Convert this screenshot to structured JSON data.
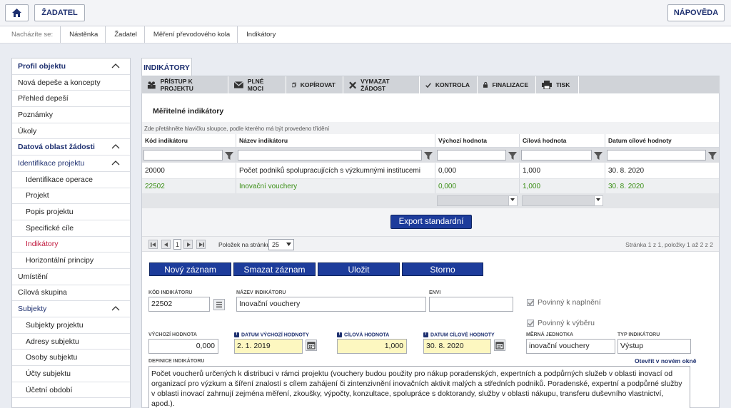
{
  "header": {
    "user_label": "ŽADATEL",
    "help_label": "NÁPOVĚDA"
  },
  "breadcrumb": [
    "Nacházíte se:",
    "Nástěnka",
    "Žadatel",
    "Měření převodového kola",
    "Indikátory"
  ],
  "sidebar": {
    "items": [
      {
        "label": "Profil objektu",
        "kind": "head",
        "chev": true
      },
      {
        "label": "Nová depeše a koncepty",
        "kind": "plain"
      },
      {
        "label": "Přehled depeší",
        "kind": "plain"
      },
      {
        "label": "Poznámky",
        "kind": "plain"
      },
      {
        "label": "Úkoly",
        "kind": "plain"
      },
      {
        "label": "Datová oblast žádosti",
        "kind": "head",
        "chev": true
      },
      {
        "label": "Identifikace projektu",
        "kind": "subhead",
        "chev": true
      },
      {
        "label": "Identifikace operace",
        "kind": "sub"
      },
      {
        "label": "Projekt",
        "kind": "sub"
      },
      {
        "label": "Popis projektu",
        "kind": "sub"
      },
      {
        "label": "Specifické cíle",
        "kind": "sub"
      },
      {
        "label": "Indikátory",
        "kind": "sub",
        "active": true
      },
      {
        "label": "Horizontální principy",
        "kind": "sub"
      },
      {
        "label": "Umístění",
        "kind": "plain"
      },
      {
        "label": "Cílová skupina",
        "kind": "plain"
      },
      {
        "label": "Subjekty",
        "kind": "subhead",
        "chev": true
      },
      {
        "label": "Subjekty projektu",
        "kind": "sub"
      },
      {
        "label": "Adresy subjektu",
        "kind": "sub"
      },
      {
        "label": "Osoby subjektu",
        "kind": "sub"
      },
      {
        "label": "Účty subjektu",
        "kind": "sub"
      },
      {
        "label": "Účetní období",
        "kind": "sub"
      }
    ]
  },
  "tab": {
    "label": "INDIKÁTORY"
  },
  "toolbar": {
    "access": "PŘÍSTUP K PROJEKTU",
    "power": "PLNÉ MOCI",
    "copy": "KOPÍROVAT",
    "delete": "VYMAZAT ŽÁDOST",
    "check": "KONTROLA",
    "finalize": "FINALIZACE",
    "print": "TISK"
  },
  "section_title": "Měřitelné indikátory",
  "grid": {
    "hint": "Zde přetáhněte hlavičku sloupce, podle kterého má být provedeno třídění",
    "columns": [
      "Kód indikátoru",
      "Název indikátoru",
      "Výchozí hodnota",
      "Cílová hodnota",
      "Datum cílové hodnoty"
    ],
    "rows": [
      [
        "20000",
        "Počet podniků spolupracujících s výzkumnými institucemi",
        "0,000",
        "1,000",
        "30. 8. 2020"
      ],
      [
        "22502",
        "Inovační vouchery",
        "0,000",
        "1,000",
        "30. 8. 2020"
      ]
    ],
    "export_label": "Export standardní"
  },
  "pager": {
    "page": "1",
    "per_page_label": "Položek na stránku",
    "per_page": "25",
    "summary": "Stránka 1 z 1, položky 1 až 2 z 2"
  },
  "actions": {
    "new": "Nový záznam",
    "delete": "Smazat záznam",
    "save": "Uložit",
    "cancel": "Storno"
  },
  "form": {
    "code_label": "KÓD INDIKÁTORU",
    "code_value": "22502",
    "name_label": "NÁZEV INDIKÁTORU",
    "name_value": "Inovační vouchery",
    "envi_label": "ENVI",
    "envi_value": "",
    "req_fulfill_label": "Povinný k naplnění",
    "req_select_label": "Povinný k výběru",
    "start_value_label": "VÝCHOZÍ HODNOTA",
    "start_value": "0,000",
    "start_date_label": "DATUM VÝCHOZÍ HODNOTY",
    "start_date": "2. 1. 2019",
    "target_value_label": "CÍLOVÁ HODNOTA",
    "target_value": "1,000",
    "target_date_label": "DATUM CÍLOVÉ HODNOTY",
    "target_date": "30. 8. 2020",
    "unit_label": "MĚRNÁ JEDNOTKA",
    "unit_value": "inovační vouchery",
    "type_label": "TYP INDIKÁTORU",
    "type_value": "Výstup",
    "definition_label": "DEFINICE INDIKÁTORU",
    "open_new_window": "Otevřít v novém okně",
    "definition_text": "Počet voucherů určených k distribuci v rámci projektu (vouchery budou použity pro nákup poradenských, expertních a podpůrných služeb v oblasti inovací od organizací pro výzkum a šíření znalostí s cílem zahájení či zintenzivnění inovačních aktivit malých a středních podniků. Poradenské, expertní a podpůrné služby v oblasti inovací zahrnují zejména měření, zkoušky, výpočty, konzultace, spolupráce s doktorandy, služby v oblasti nákupu, transferu duševního vlastnictví, apod.)."
  }
}
